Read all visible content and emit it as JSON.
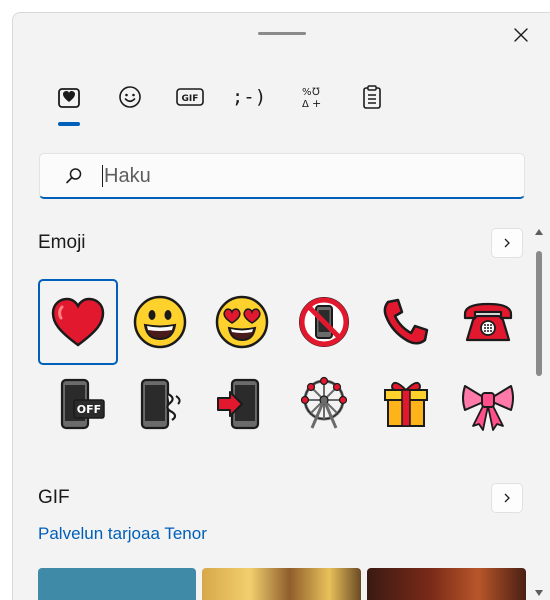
{
  "window": {
    "close_label": "Close"
  },
  "tabs": [
    {
      "name": "emoji",
      "label": "Emoji"
    },
    {
      "name": "smiley",
      "label": "Kaomoji smiley"
    },
    {
      "name": "gif",
      "label": "GIF"
    },
    {
      "name": "kaomoji",
      "label": ";-)"
    },
    {
      "name": "symbols",
      "label": "%℧ Δ+"
    },
    {
      "name": "clipboard",
      "label": "Clipboard"
    }
  ],
  "search": {
    "placeholder": "Haku",
    "value": ""
  },
  "emoji_section": {
    "title": "Emoji",
    "items": [
      {
        "name": "red-heart",
        "selected": true
      },
      {
        "name": "grinning-face"
      },
      {
        "name": "smiling-face-with-heart-eyes"
      },
      {
        "name": "no-mobile-phones"
      },
      {
        "name": "telephone-receiver"
      },
      {
        "name": "telephone"
      },
      {
        "name": "mobile-phone-off"
      },
      {
        "name": "vibration-mode"
      },
      {
        "name": "mobile-phone-with-arrow"
      },
      {
        "name": "ferris-wheel"
      },
      {
        "name": "wrapped-gift"
      },
      {
        "name": "ribbon"
      }
    ]
  },
  "gif_section": {
    "title": "GIF",
    "provider_text": "Palvelun tarjoaa Tenor"
  },
  "colors": {
    "accent": "#005fb8",
    "panel_bg": "#f3f3f3",
    "heart_red": "#e2192e",
    "emoji_yellow": "#ffd12c"
  }
}
